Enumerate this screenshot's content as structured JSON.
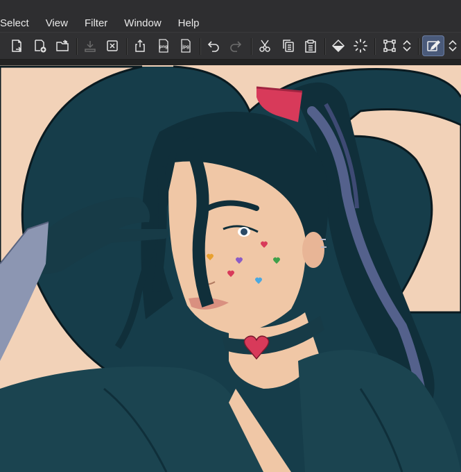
{
  "menu": {
    "items": [
      {
        "label": "Select"
      },
      {
        "label": "View"
      },
      {
        "label": "Filter"
      },
      {
        "label": "Window"
      },
      {
        "label": "Help"
      }
    ]
  },
  "toolbar": {
    "buttons": [
      {
        "name": "new-canvas-icon"
      },
      {
        "name": "new-from-clipboard-icon"
      },
      {
        "name": "open-folder-icon"
      },
      {
        "name": "save-icon",
        "disabled": true
      },
      {
        "name": "close-file-icon"
      },
      {
        "name": "export-icon"
      },
      {
        "name": "export-png-icon",
        "text": "png"
      },
      {
        "name": "export-jpg-icon",
        "text": "jpg"
      },
      {
        "name": "undo-icon"
      },
      {
        "name": "redo-icon",
        "disabled": true
      },
      {
        "name": "cut-icon"
      },
      {
        "name": "copy-icon"
      },
      {
        "name": "paste-icon"
      },
      {
        "name": "fill-icon"
      },
      {
        "name": "loading-icon"
      },
      {
        "name": "transform-icon"
      },
      {
        "name": "arrows-updown-icon"
      },
      {
        "name": "edit-active-icon",
        "active": true
      },
      {
        "name": "chevron-updown-icon"
      }
    ]
  },
  "colors": {
    "menubar_bg": "#2e2e30",
    "toolbar_bg": "#303032",
    "icon": "#e4e4e4",
    "icon_disabled": "#6c6c6c",
    "active_bg": "#4a5a7a",
    "canvas_bg": "#f2d2b8",
    "heart_teal": "#163d4a",
    "hair": "#102f3a",
    "hair_highlight": "#5c6796",
    "skin": "#f0c7a6",
    "ribbon": "#d83a5a",
    "choker": "#173b47",
    "jacket": "#1b4450",
    "sleeve_gray": "#8c96b2"
  }
}
